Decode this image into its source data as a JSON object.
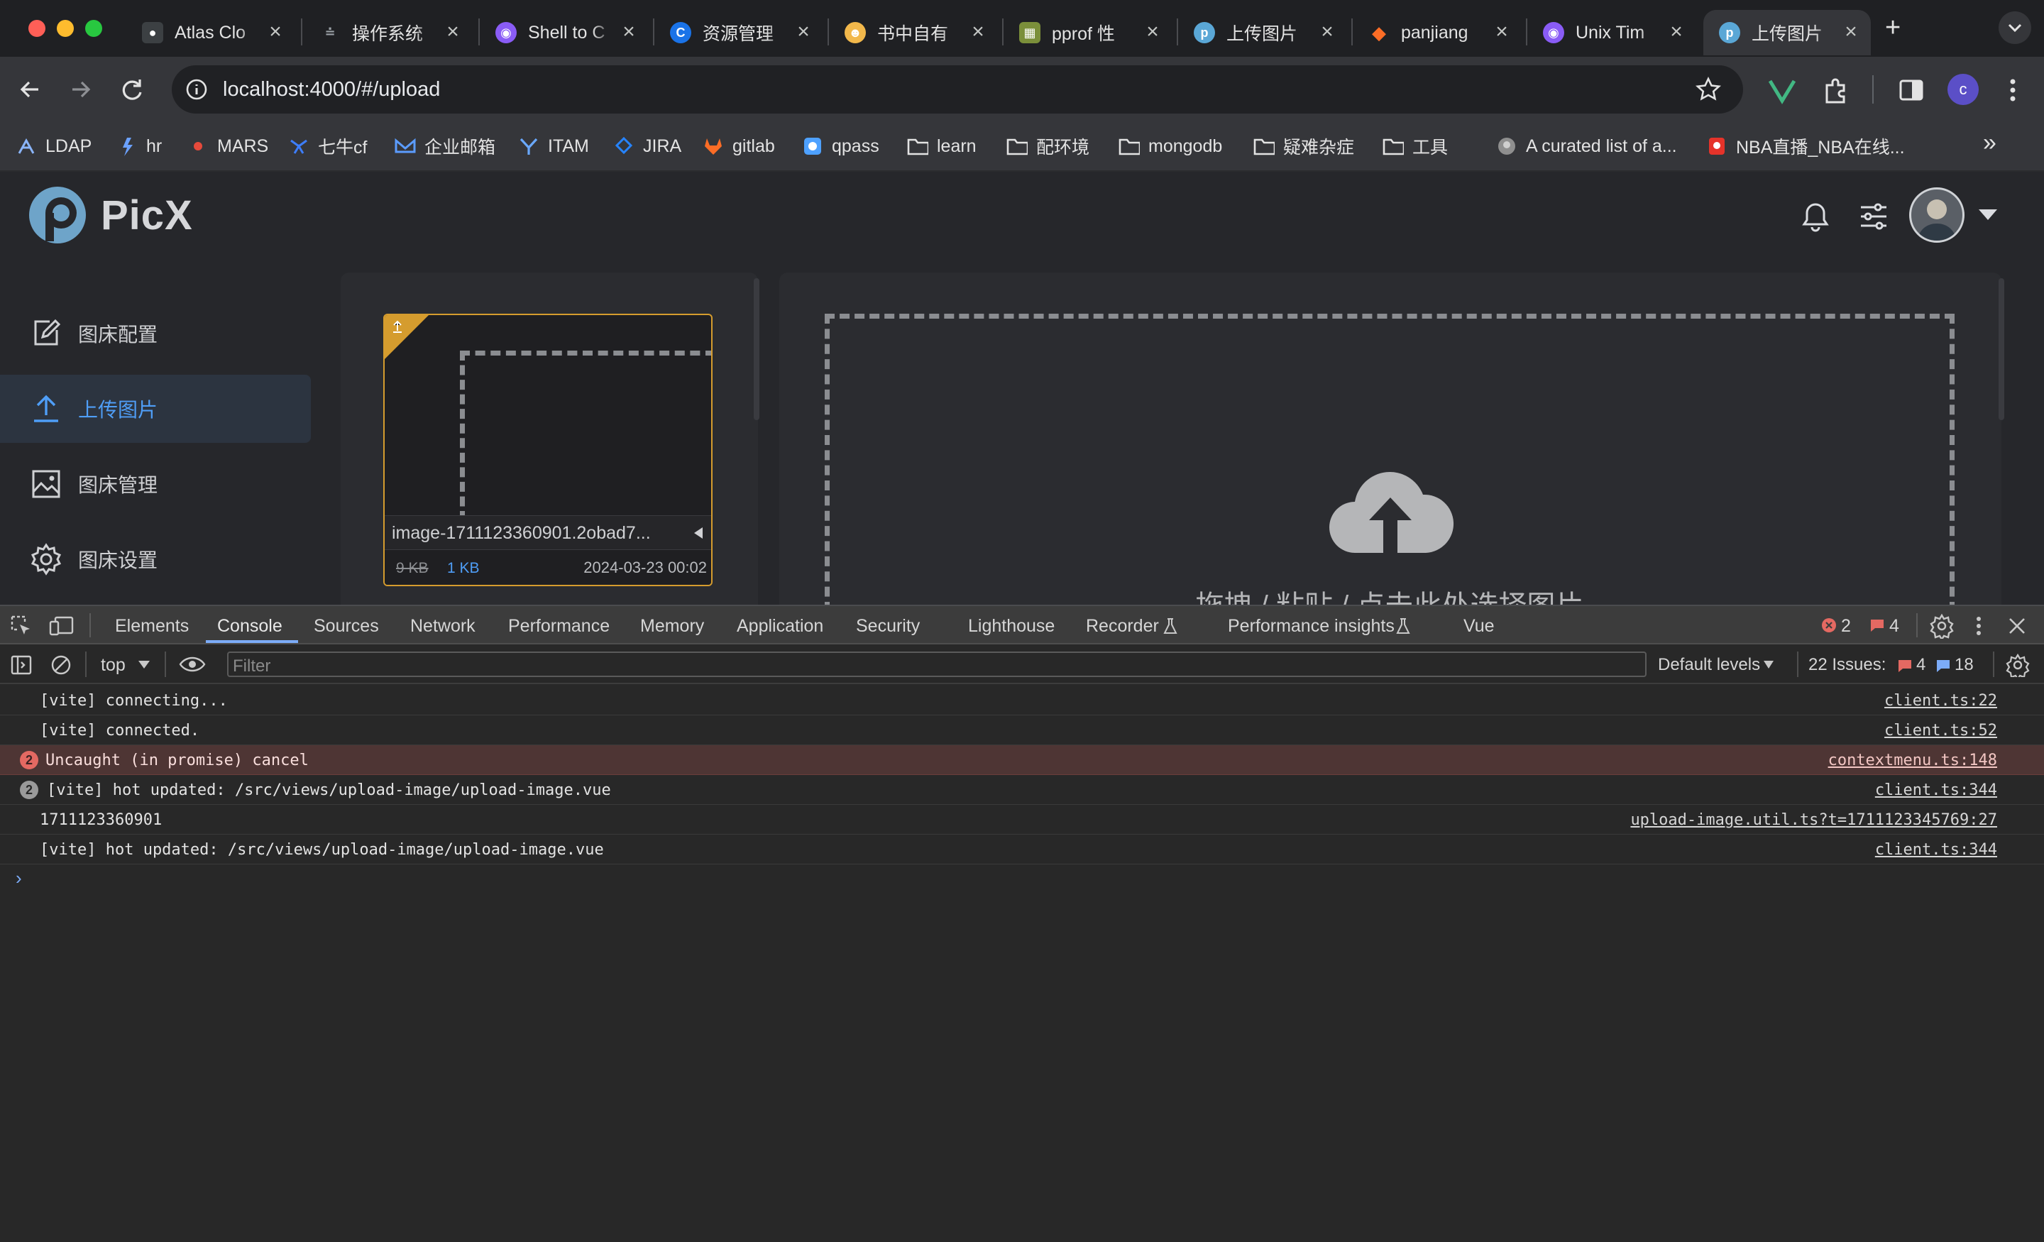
{
  "browser": {
    "tabs": [
      {
        "title": "Atlas Clo",
        "icon": "atlas-icon",
        "color": "#8ab4f8"
      },
      {
        "title": "操作系统",
        "icon": "doc-icon",
        "color": "#9aa0a6"
      },
      {
        "title": "Shell to C",
        "icon": "chatgpt-icon",
        "color": "#8a5cf6"
      },
      {
        "title": "资源管理",
        "icon": "resource-icon",
        "color": "#1a73e8"
      },
      {
        "title": "书中自有",
        "icon": "book-icon",
        "color": "#f2b84b"
      },
      {
        "title": "pprof 性",
        "icon": "image-icon",
        "color": "#7b8f3a"
      },
      {
        "title": "上传图片",
        "icon": "picx-icon",
        "color": "#5aa7d6"
      },
      {
        "title": "panjiang",
        "icon": "gitlab-icon",
        "color": "#fc6d26"
      },
      {
        "title": "Unix Tim",
        "icon": "chatgpt-icon",
        "color": "#8a5cf6"
      },
      {
        "title": "上传图片",
        "icon": "picx-icon",
        "color": "#5aa7d6",
        "active": true
      }
    ],
    "new_tab": "+",
    "url": "localhost:4000/#/upload",
    "profile_letter": "c",
    "bookmarks": [
      {
        "label": "LDAP",
        "icon": "ldap-icon"
      },
      {
        "label": "hr",
        "icon": "hr-icon"
      },
      {
        "label": "MARS",
        "icon": "mars-icon"
      },
      {
        "label": "七牛cf",
        "icon": "qiniu-icon"
      },
      {
        "label": "企业邮箱",
        "icon": "mail-icon"
      },
      {
        "label": "ITAM",
        "icon": "itam-icon"
      },
      {
        "label": "JIRA",
        "icon": "jira-icon"
      },
      {
        "label": "gitlab",
        "icon": "gitlab-icon"
      },
      {
        "label": "qpass",
        "icon": "qpass-icon"
      },
      {
        "label": "learn",
        "icon": "folder-icon"
      },
      {
        "label": "配环境",
        "icon": "folder-icon"
      },
      {
        "label": "mongodb",
        "icon": "folder-icon"
      },
      {
        "label": "疑难杂症",
        "icon": "folder-icon"
      },
      {
        "label": "工具",
        "icon": "folder-icon"
      },
      {
        "label": "A curated list of a...",
        "icon": "github-icon"
      },
      {
        "label": "NBA直播_NBA在线...",
        "icon": "nba-icon"
      }
    ],
    "bookmarks_overflow": "»"
  },
  "app": {
    "logo_text": "PicX",
    "nav": [
      {
        "label": "图床配置",
        "icon": "edit-config-icon"
      },
      {
        "label": "上传图片",
        "icon": "upload-icon",
        "active": true
      },
      {
        "label": "图床管理",
        "icon": "image-manage-icon"
      },
      {
        "label": "图床设置",
        "icon": "settings-gear-icon"
      }
    ],
    "upload_item": {
      "filename": "image-1711123360901.2obad7...",
      "original_size": "9 KB",
      "compressed_size": "1 KB",
      "date": "2024-03-23 00:02"
    },
    "dropzone_hint": "拖拽 / 粘贴 / 点击此处选择图片"
  },
  "devtools": {
    "tabs": [
      "Elements",
      "Console",
      "Sources",
      "Network",
      "Performance",
      "Memory",
      "Application",
      "Security",
      "Lighthouse",
      "Recorder",
      "Performance insights",
      "Vue"
    ],
    "active_tab": "Console",
    "error_count": "2",
    "warning_count": "4",
    "context": "top",
    "filter_placeholder": "Filter",
    "levels": "Default levels",
    "issues_label": "22 Issues:",
    "issues_warn": "4",
    "issues_info": "18",
    "logs": [
      {
        "text": "[vite] connecting...",
        "source": "client.ts:22",
        "type": "log"
      },
      {
        "text": "[vite] connected.",
        "source": "client.ts:52",
        "type": "log"
      },
      {
        "text": "Uncaught (in promise) cancel",
        "source": "contextmenu.ts:148",
        "type": "error",
        "count": "2"
      },
      {
        "text": "[vite] hot updated: /src/views/upload-image/upload-image.vue",
        "source": "client.ts:344",
        "type": "repeat",
        "count": "2"
      },
      {
        "text": "1711123360901",
        "source": "upload-image.util.ts?t=1711123345769:27",
        "type": "log"
      },
      {
        "text": "[vite] hot updated: /src/views/upload-image/upload-image.vue",
        "source": "client.ts:344",
        "type": "log"
      }
    ],
    "prompt": "›"
  }
}
